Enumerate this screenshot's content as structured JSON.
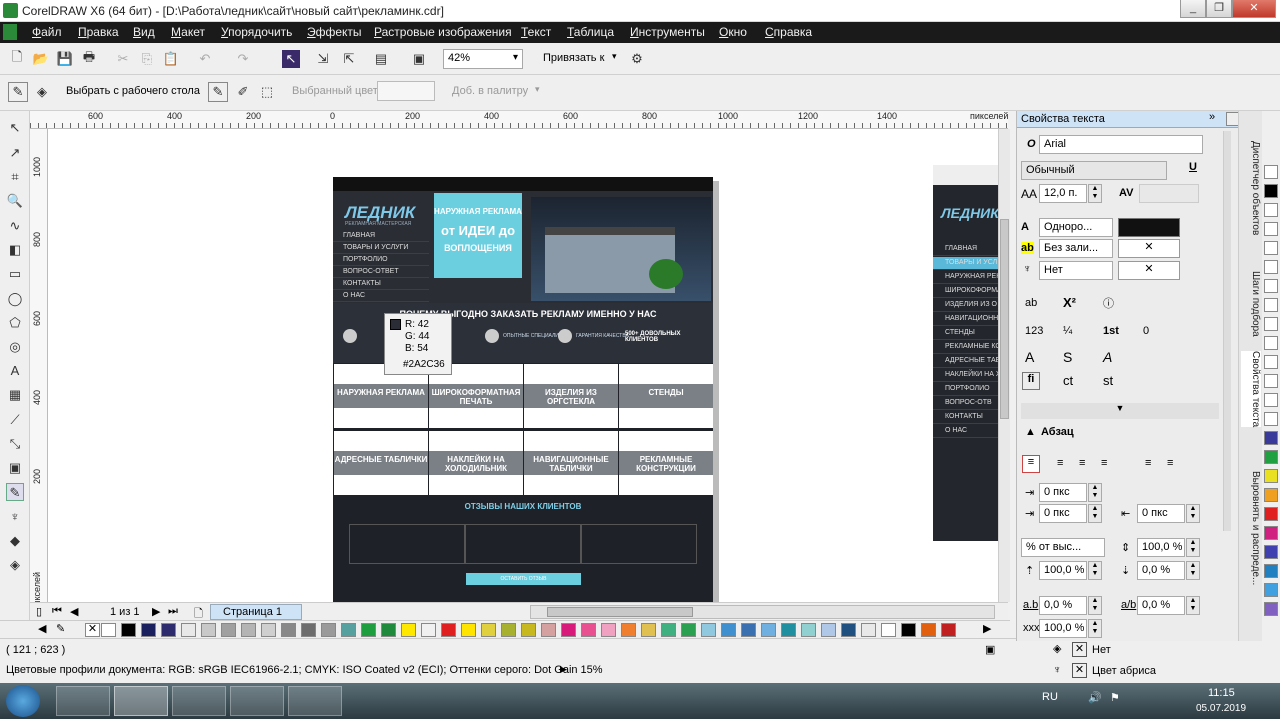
{
  "window": {
    "title": "CorelDRAW X6 (64 бит) - [D:\\Работа\\ледник\\сайт\\новый сайт\\рекламинк.cdr]",
    "min": "_",
    "restore": "❐",
    "close": "✕"
  },
  "menu": [
    "Файл",
    "Правка",
    "Вид",
    "Макет",
    "Упорядочить",
    "Эффекты",
    "Растровые изображения",
    "Текст",
    "Таблица",
    "Инструменты",
    "Окно",
    "Справка"
  ],
  "toolbar": {
    "zoom": "42%",
    "snap": "Привязать к"
  },
  "propbar": {
    "select_from_desktop": "Выбрать с рабочего стола",
    "selected_color": "Выбранный цвет",
    "add_to_palette": "Доб. в палитру"
  },
  "ruler": {
    "top_labels": [
      "600",
      "400",
      "200",
      "0",
      "200",
      "400",
      "600",
      "800",
      "1000",
      "1200",
      "1400"
    ],
    "units": "пикселей",
    "left_labels": [
      "1000",
      "800",
      "600",
      "400",
      "200"
    ]
  },
  "color_tooltip": {
    "r": "R: 42",
    "g": "G: 44",
    "b": "B: 54",
    "hex": "#2A2C36",
    "swatch": "#2a2c36"
  },
  "site": {
    "brand": "ЛЕДНИК",
    "brand_sub": "РЕКЛАМНАЯ МАСТЕРСКАЯ",
    "nav": [
      "ГЛАВНАЯ",
      "ТОВАРЫ И УСЛУГИ",
      "ПОРТФОЛИО",
      "ВОПРОС-ОТВЕТ",
      "КОНТАКТЫ",
      "О НАС"
    ],
    "promo_line1": "НАРУЖНАЯ РЕКЛАМА",
    "promo_line2": "от ИДЕИ до",
    "promo_line3": "ВОПЛОЩЕНИЯ",
    "headline": "ПОЧЕМУ ВЫГОДНО ЗАКАЗАТЬ РЕКЛАМУ ИМЕННО У НАС",
    "features": [
      "ОПЫТНЫЕ СПЕЦИАЛИСТЫ",
      "ГАРАНТИЯ КАЧЕСТВА",
      "500+ ДОВОЛЬНЫХ КЛИЕНТОВ"
    ],
    "tiles": [
      "НАРУЖНАЯ РЕКЛАМА",
      "ШИРОКОФОРМАТНАЯ ПЕЧАТЬ",
      "ИЗДЕЛИЯ ИЗ ОРГСТЕКЛА",
      "СТЕНДЫ",
      "АДРЕСНЫЕ ТАБЛИЧКИ",
      "НАКЛЕЙКИ НА ХОЛОДИЛЬНИК",
      "НАВИГАЦИОННЫЕ ТАБЛИЧКИ",
      "РЕКЛАМНЫЕ КОНСТРУКЦИИ"
    ],
    "reviews": "ОТЗЫВЫ НАШИХ КЛИЕНТОВ",
    "review_btn": "ОСТАВИТЬ ОТЗЫВ"
  },
  "site2": {
    "nav": [
      "ГЛАВНАЯ",
      "ТОВАРЫ И УСЛ",
      "НАРУЖНАЯ РЕК",
      "ШИРОКОФОРМА",
      "ИЗДЕЛИЯ ИЗ О",
      "НАВИГАЦИОННЫ",
      "СТЕНДЫ",
      "РЕКЛАМНЫЕ КОН",
      "АДРЕСНЫЕ ТАБ",
      "НАКЛЕЙКИ НА ХОЛ",
      "ПОРТФОЛИО",
      "ВОПРОС-ОТВ",
      "КОНТАКТЫ",
      "О НАС"
    ]
  },
  "pagebar": {
    "counter": "1 из 1",
    "page_tab": "Страница 1"
  },
  "palette": [
    "#ffffff",
    "#000000",
    "#1a1f5e",
    "#2d2a6e",
    "#e8e8e8",
    "#c8c8c8",
    "#a0a0a0",
    "#b4b4b4",
    "#cfcfcf",
    "#888888",
    "#6d6d6d",
    "#9a9a9a",
    "#56a0a0",
    "#1e9e3e",
    "#1f8a3c",
    "#ffe800",
    "#f0f0f0",
    "#e02020",
    "#ffe400",
    "#e0d040",
    "#a8b030",
    "#c8b820",
    "#d4a0a0",
    "#d81a7a",
    "#e85090",
    "#f0a0c0",
    "#f08030",
    "#e0c050",
    "#40b080",
    "#2aa050",
    "#90c8e0",
    "#4090d0",
    "#3a70b0",
    "#70b0e0",
    "#2090a0",
    "#90d0d0",
    "#b0c8e8",
    "#205080",
    "#e8e8e8",
    "#ffffff",
    "#000000",
    "#e06010",
    "#c02020"
  ],
  "status": {
    "coords": "( 121 ; 623 )",
    "profiles": "Цветовые профили документа: RGB: sRGB IEC61966-2.1; CMYK: ISO Coated v2 (ECI); Оттенки серого: Dot Gain 15%",
    "fill": "Нет",
    "outline": "Цвет абриса"
  },
  "docker": {
    "title": "Свойства текста",
    "font": "Arial",
    "style": "Обычный",
    "size": "12,0 п.",
    "fill_uniform": "Одноро...",
    "bg_none": "Без зали...",
    "outline_none": "Нет",
    "para_header": "Абзац",
    "indent1": "0 пкс",
    "indent2": "0 пкс",
    "indent3": "0 пкс",
    "spacing_mode": "% от выс...",
    "line_spacing": "100,0 %",
    "before": "100,0 %",
    "after": "0,0 %",
    "char_spacing": "0,0 %",
    "word_spacing": "0,0 %",
    "lang_spacing": "100,0 %"
  },
  "vtabs": [
    "Диспетчер объектов",
    "Шаги подбора",
    "Свойства текста",
    "Выровнять и распреде..."
  ],
  "right_palette": [
    "#ffffff",
    "#000000",
    "#ffffff",
    "#ffffff",
    "#ffffff",
    "#ffffff",
    "#ffffff",
    "#ffffff",
    "#ffffff",
    "#ffffff",
    "#ffffff",
    "#ffffff",
    "#ffffff",
    "#ffffff",
    "#3a3a9a",
    "#20a040",
    "#e8e020",
    "#f0a020",
    "#e02020",
    "#d02080",
    "#4040b0",
    "#2080c0",
    "#40a0e0",
    "#8060c0"
  ],
  "taskbar": {
    "lang": "RU",
    "time": "11:15",
    "date": "05.07.2019"
  }
}
